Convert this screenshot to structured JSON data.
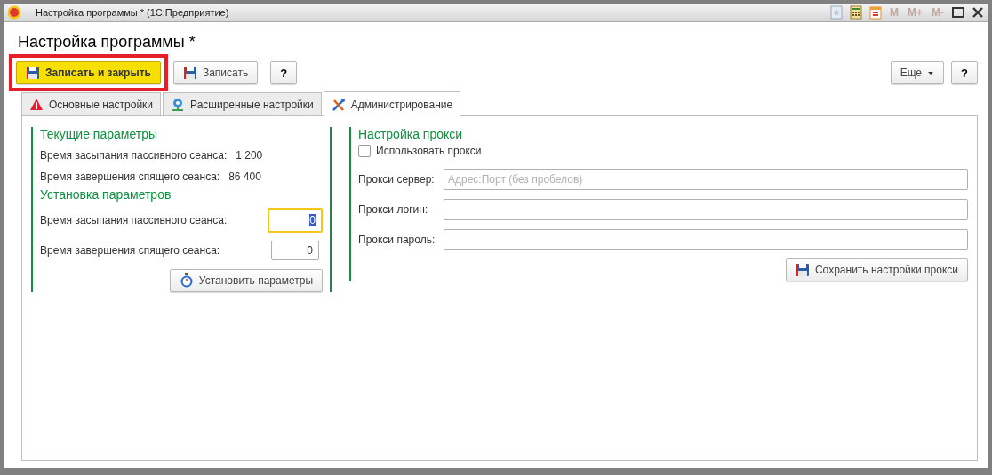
{
  "window": {
    "title": "Настройка программы * (1С:Предприятие)",
    "memory_buttons": [
      "M",
      "M+",
      "M-"
    ]
  },
  "form_title": "Настройка программы *",
  "toolbar": {
    "left": [
      {
        "label": "Записать и закрыть",
        "kind": "primary",
        "highlighted": true
      },
      {
        "label": "Записать",
        "kind": "save",
        "highlighted": false
      },
      {
        "label": "?",
        "kind": "help",
        "highlighted": false
      }
    ],
    "right": [
      {
        "label": "Еще",
        "kind": "menu"
      },
      {
        "label": "?",
        "kind": "help"
      }
    ]
  },
  "tabs": [
    {
      "label": "Основные настройки",
      "kind": "warning",
      "selected": false
    },
    {
      "label": "Расширенные настройки",
      "kind": "network",
      "selected": false
    },
    {
      "label": "Администрирование",
      "kind": "tools",
      "selected": true
    }
  ],
  "current": {
    "heading": "Текущие параметры",
    "rows": [
      {
        "label": "Время засыпания пассивного сеанса:",
        "value": "1 200"
      },
      {
        "label": "Время завершения спящего сеанса:",
        "value": "86 400"
      }
    ]
  },
  "setup": {
    "heading": "Установка параметров",
    "fields": [
      {
        "label": "Время засыпания пассивного сеанса:",
        "value": "0",
        "focused": true
      },
      {
        "label": "Время завершения спящего сеанса:",
        "value": "0",
        "focused": false
      }
    ],
    "button": "Установить параметры"
  },
  "proxy": {
    "heading": "Настройка прокси",
    "use_proxy": {
      "label": "Использовать прокси",
      "checked": false
    },
    "fields": [
      {
        "label": "Прокси сервер:",
        "placeholder": "Адрес:Порт (без пробелов)"
      },
      {
        "label": "Прокси логин:"
      },
      {
        "label": "Прокси пароль:"
      }
    ],
    "button": "Сохранить настройки прокси"
  }
}
